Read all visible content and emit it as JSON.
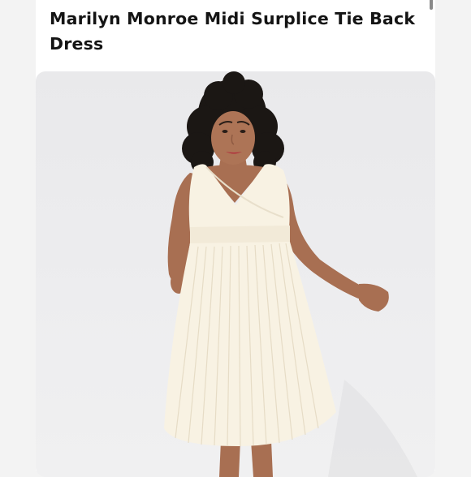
{
  "product": {
    "title": "Marilyn Monroe Midi Surplice Tie Back Dress"
  },
  "image": {
    "subject": "model-wearing-white-pleated-dress",
    "background_color": "#ececee",
    "dress_color": "#f8f2e3",
    "skin_color": "#a86f52",
    "hair_color": "#1b1714"
  }
}
